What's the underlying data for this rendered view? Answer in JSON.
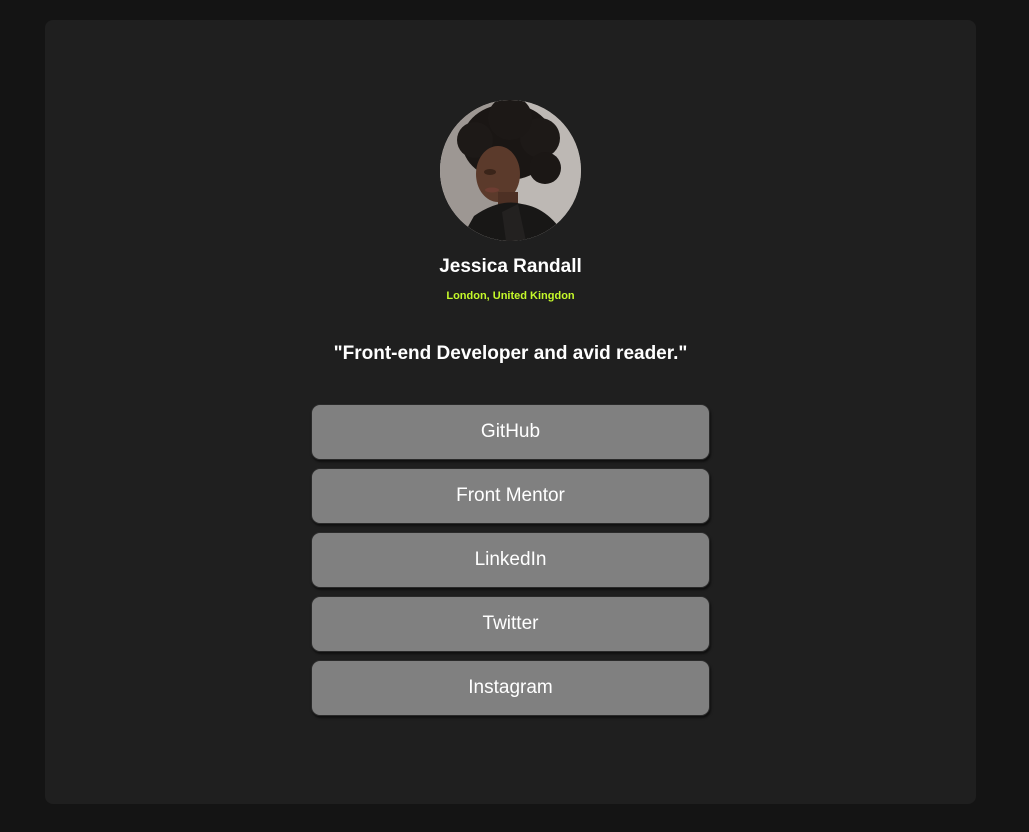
{
  "profile": {
    "name": "Jessica Randall",
    "location": "London, United Kingdon",
    "bio": "\"Front-end Developer and avid reader.\"",
    "avatar_icon": "profile-photo"
  },
  "links": [
    {
      "label": "GitHub"
    },
    {
      "label": "Front Mentor"
    },
    {
      "label": "LinkedIn"
    },
    {
      "label": "Twitter"
    },
    {
      "label": "Instagram"
    }
  ],
  "colors": {
    "page_background": "#141414",
    "card_background": "#1f1f1f",
    "accent": "#c4f82a",
    "button_background": "#808080",
    "text": "#ffffff"
  }
}
